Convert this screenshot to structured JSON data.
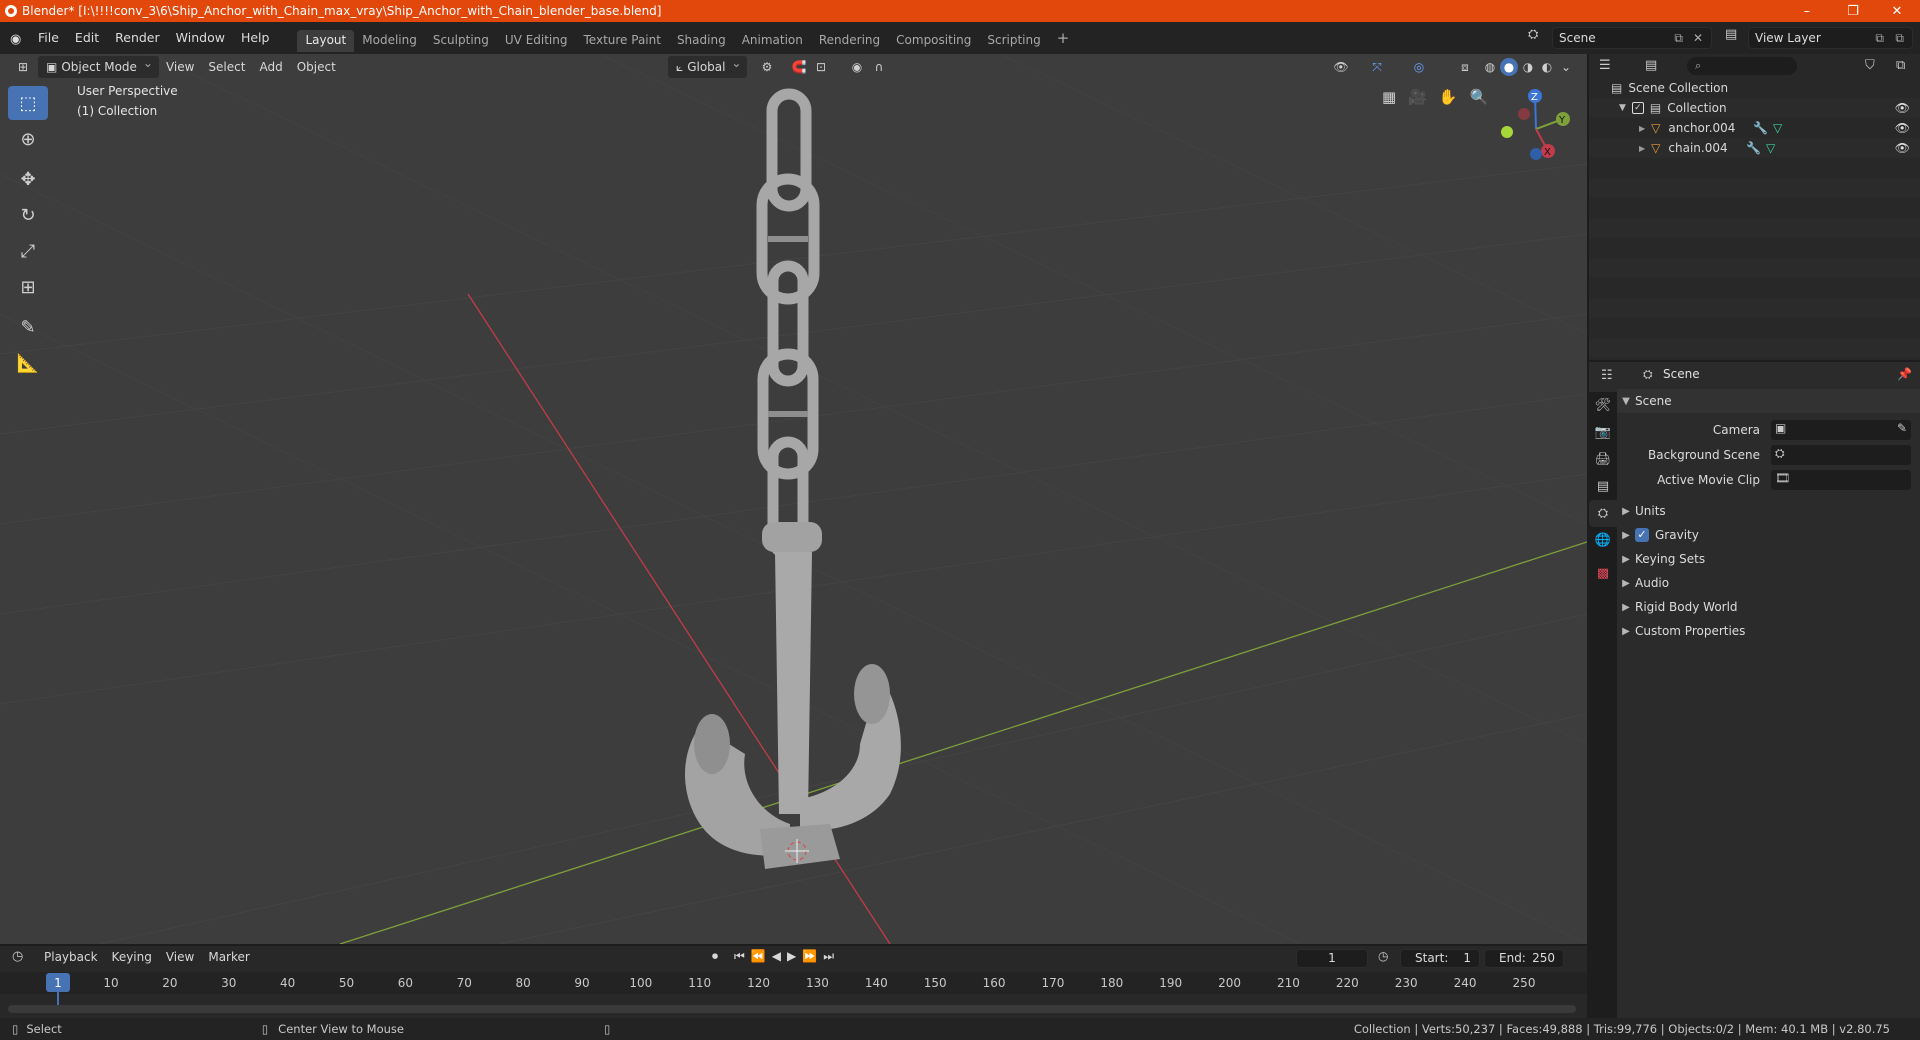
{
  "window": {
    "title": "Blender* [I:\\!!!!conv_3\\6\\Ship_Anchor_with_Chain_max_vray\\Ship_Anchor_with_Chain_blender_base.blend]"
  },
  "menu": [
    "File",
    "Edit",
    "Render",
    "Window",
    "Help"
  ],
  "workspaces": [
    "Layout",
    "Modeling",
    "Sculpting",
    "UV Editing",
    "Texture Paint",
    "Shading",
    "Animation",
    "Rendering",
    "Compositing",
    "Scripting"
  ],
  "scene_field": "Scene",
  "view_layer_field": "View Layer",
  "viewport": {
    "mode": "Object Mode",
    "menus": [
      "View",
      "Select",
      "Add",
      "Object"
    ],
    "transform_orientation": "Global",
    "perspective_label": "User Perspective",
    "collection_label": "(1) Collection",
    "gizmo": {
      "z": "Z",
      "y": "Y",
      "x": "X"
    }
  },
  "outliner": {
    "root": "Scene Collection",
    "collection": "Collection",
    "objects": [
      "anchor.004",
      "chain.004"
    ]
  },
  "properties": {
    "context": "Scene",
    "panel": "Scene",
    "fields": [
      "Camera",
      "Background Scene",
      "Active Movie Clip"
    ],
    "sections": [
      "Units",
      "Gravity",
      "Keying Sets",
      "Audio",
      "Rigid Body World",
      "Custom Properties"
    ]
  },
  "timeline": {
    "menus": [
      "Playback",
      "Keying",
      "View",
      "Marker"
    ],
    "current_frame": "1",
    "start_label": "Start:",
    "start": "1",
    "end_label": "End:",
    "end": "250",
    "ticks": [
      "1",
      "10",
      "20",
      "30",
      "40",
      "50",
      "60",
      "70",
      "80",
      "90",
      "100",
      "110",
      "120",
      "130",
      "140",
      "150",
      "160",
      "170",
      "180",
      "190",
      "200",
      "210",
      "220",
      "230",
      "240",
      "250"
    ]
  },
  "status": {
    "left": "Select",
    "middle": "Center View to Mouse",
    "right": "Collection | Verts:50,237 | Faces:49,888 | Tris:99,776 | Objects:0/2 | Mem: 40.1 MB | v2.80.75"
  },
  "colors": {
    "titlebar": "#e2470c",
    "accent": "#4772b3",
    "viewport_bg": "#3d3d3d",
    "axis_x": "#c23b4a",
    "axis_y": "#7ea03a"
  }
}
